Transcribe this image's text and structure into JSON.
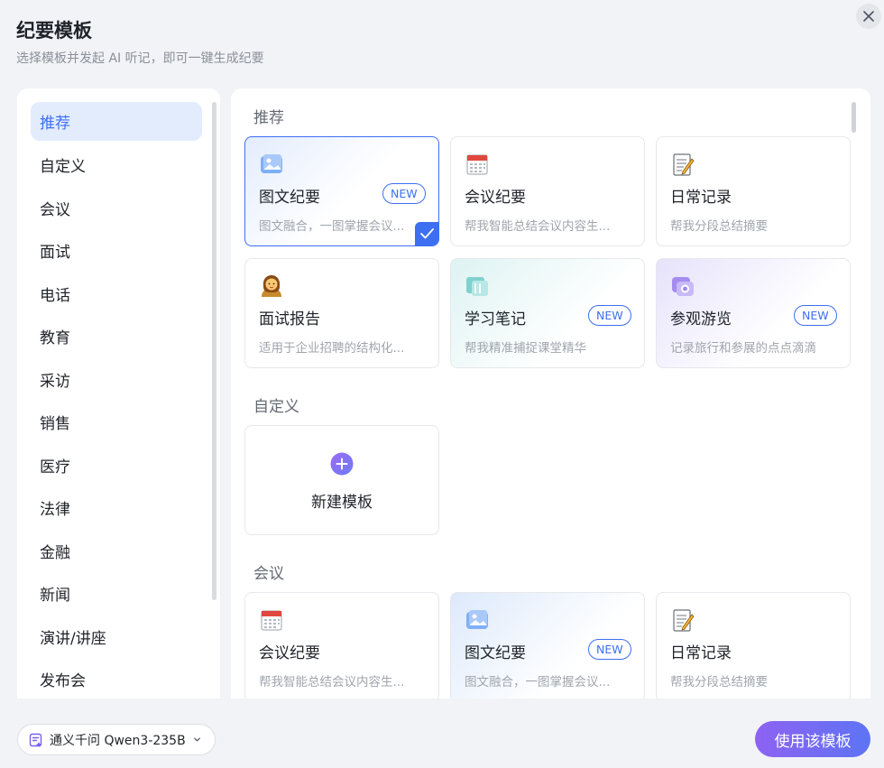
{
  "header": {
    "title": "纪要模板",
    "subtitle": "选择模板并发起 AI 听记，即可一键生成纪要"
  },
  "sidebar": {
    "items": [
      "推荐",
      "自定义",
      "会议",
      "面试",
      "电话",
      "教育",
      "采访",
      "销售",
      "医疗",
      "法律",
      "金融",
      "新闻",
      "演讲/讲座",
      "发布会"
    ],
    "active": "推荐"
  },
  "sections": {
    "recommended": {
      "title": "推荐",
      "cards": [
        {
          "name": "图文纪要",
          "desc": "图文融合，一图掌握会议...",
          "badge": "NEW",
          "icon": "image-icon",
          "selected": true
        },
        {
          "name": "会议纪要",
          "desc": "帮我智能总结会议内容生...",
          "icon": "calendar-icon"
        },
        {
          "name": "日常记录",
          "desc": "帮我分段总结摘要",
          "icon": "memo-icon"
        },
        {
          "name": "面试报告",
          "desc": "适用于企业招聘的结构化...",
          "icon": "person-icon"
        },
        {
          "name": "学习笔记",
          "desc": "帮我精准捕捉课堂精华",
          "badge": "NEW",
          "icon": "book-icon"
        },
        {
          "name": "参观游览",
          "desc": "记录旅行和参展的点点滴滴",
          "badge": "NEW",
          "icon": "camera-icon"
        }
      ]
    },
    "custom": {
      "title": "自定义",
      "new_template_label": "新建模板"
    },
    "meeting": {
      "title": "会议",
      "cards": [
        {
          "name": "会议纪要",
          "desc": "帮我智能总结会议内容生...",
          "icon": "calendar-icon"
        },
        {
          "name": "图文纪要",
          "desc": "图文融合，一图掌握会议...",
          "badge": "NEW",
          "icon": "image-icon"
        },
        {
          "name": "日常记录",
          "desc": "帮我分段总结摘要",
          "icon": "memo-icon"
        }
      ]
    }
  },
  "footer": {
    "model_label": "通义千问 Qwen3-235B",
    "use_button": "使用该模板"
  },
  "colors": {
    "accent": "#3d6ff1",
    "active_bg": "#e3ecfd",
    "button_start": "#8e62f2",
    "button_end": "#5d74f4"
  }
}
